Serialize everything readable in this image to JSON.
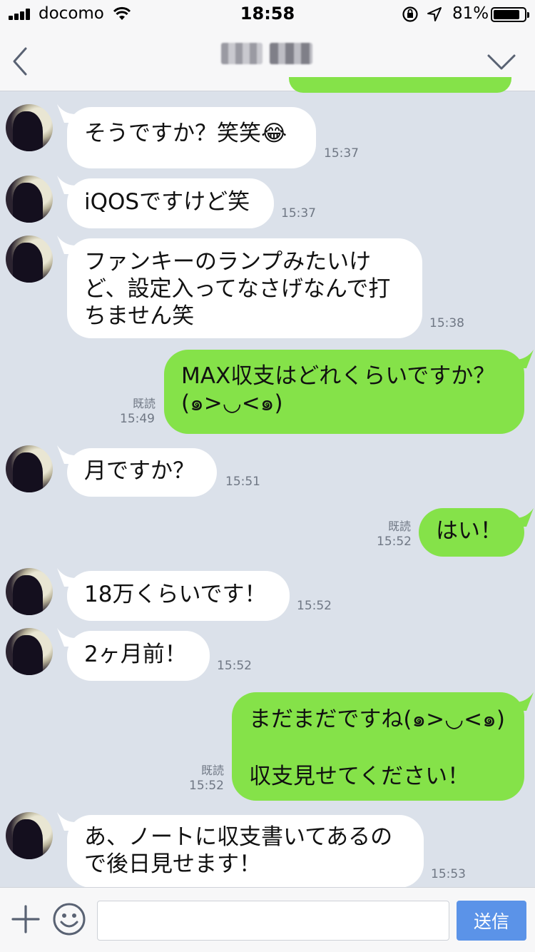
{
  "status": {
    "carrier": "docomo",
    "time": "18:58",
    "battery": "81%"
  },
  "header": {
    "title": ""
  },
  "messages": [
    {
      "side": "in",
      "text": "そうですか？笑笑😂",
      "time": "15:37"
    },
    {
      "side": "in",
      "text": "iQOSですけど笑",
      "time": "15:37"
    },
    {
      "side": "in",
      "text": "ファンキーのランプみたいけ\nど、設定入ってなさげなんで打\nちません笑",
      "time": "15:38"
    },
    {
      "side": "out",
      "text": "MAX収支はどれくらいですか？\n(๑>◡<๑)",
      "time": "15:49",
      "read": "既読"
    },
    {
      "side": "in",
      "text": "月ですか？",
      "time": "15:51"
    },
    {
      "side": "out",
      "text": "はい！",
      "time": "15:52",
      "read": "既読"
    },
    {
      "side": "in",
      "text": "18万くらいです！",
      "time": "15:52"
    },
    {
      "side": "in",
      "text": "2ヶ月前！",
      "time": "15:52"
    },
    {
      "side": "out",
      "text": "まだまだですね(๑>◡<๑)\n\n収支見せてください！",
      "time": "15:52",
      "read": "既読"
    },
    {
      "side": "in",
      "text": "あ、ノートに収支書いてあるの\nで後日見せます！",
      "time": "15:53"
    }
  ],
  "input": {
    "placeholder": "",
    "send_label": "送信"
  },
  "colors": {
    "chat_bg": "#dbe1ea",
    "outgoing": "#85e249",
    "incoming": "#ffffff",
    "send": "#5b93e8"
  }
}
